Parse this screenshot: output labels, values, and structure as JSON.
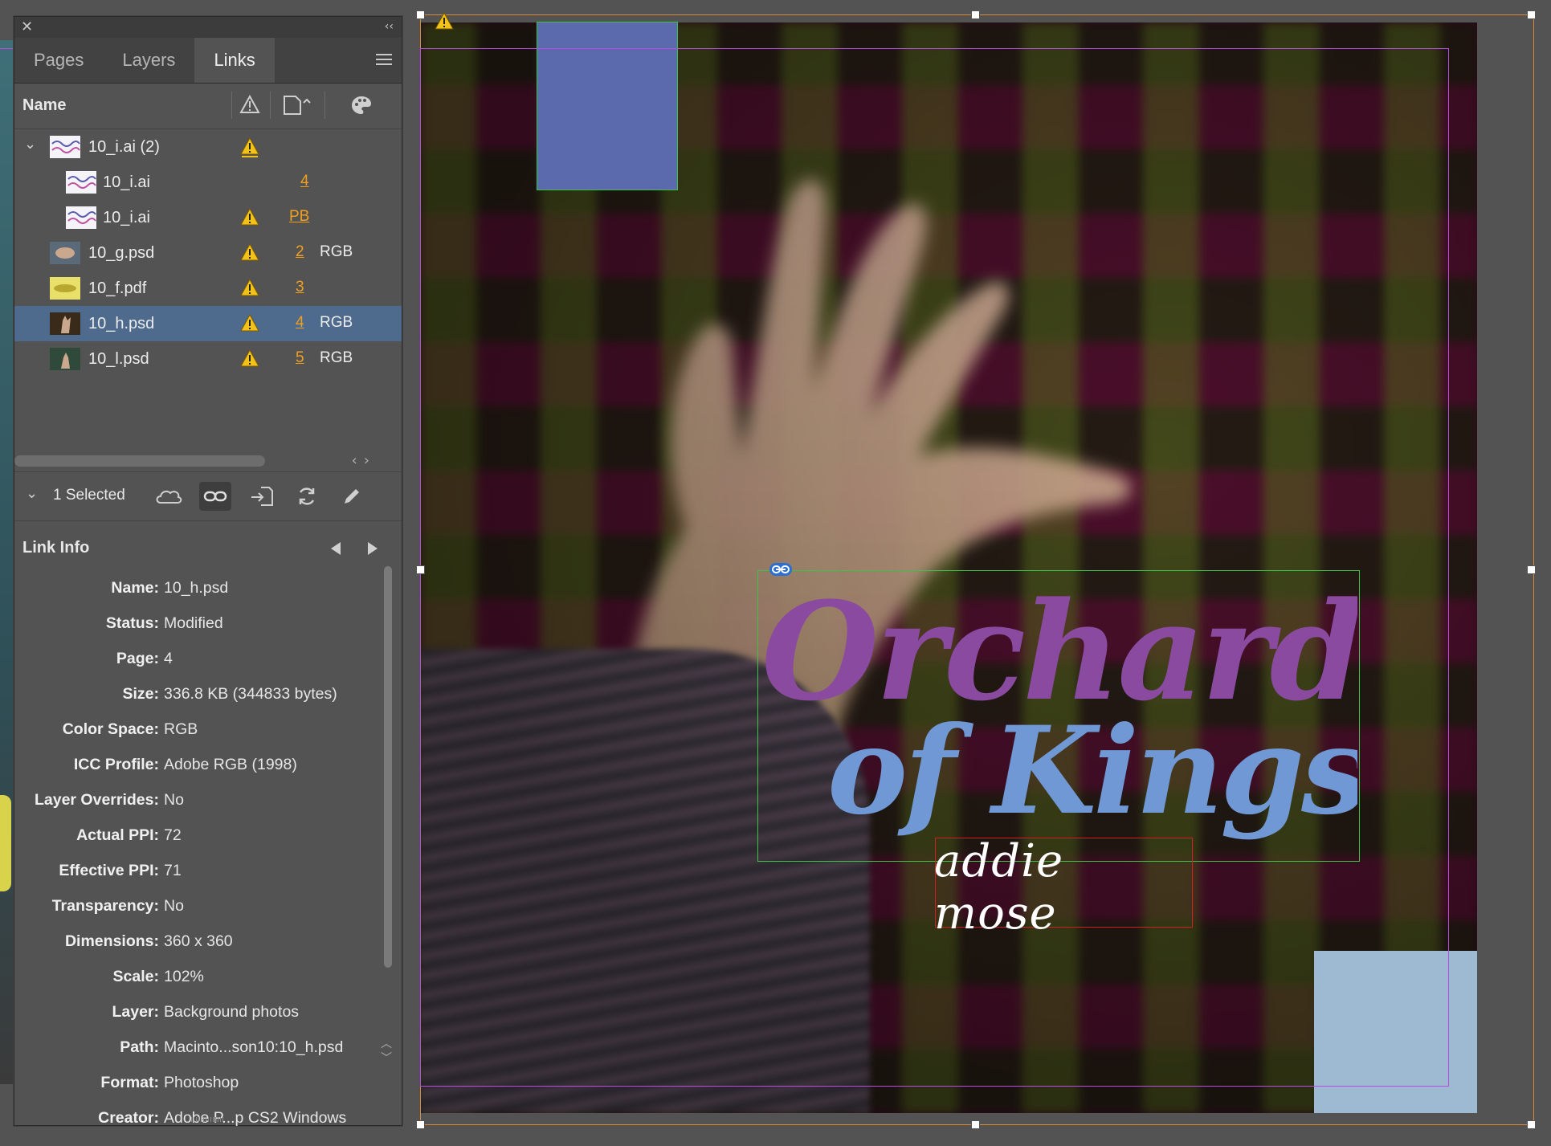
{
  "panel": {
    "tabs": [
      {
        "label": "Pages"
      },
      {
        "label": "Layers"
      },
      {
        "label": "Links"
      }
    ],
    "active_tab": "Links",
    "column_header": {
      "name": "Name"
    },
    "links": [
      {
        "name": "10_i.ai (2)",
        "page": "",
        "color_space": "",
        "warning": true,
        "expanded": true
      },
      {
        "name": "10_i.ai",
        "page": "4",
        "color_space": "",
        "warning": false
      },
      {
        "name": "10_i.ai",
        "page": "PB",
        "color_space": "",
        "warning": true
      },
      {
        "name": "10_g.psd",
        "page": "2",
        "color_space": "RGB",
        "warning": true
      },
      {
        "name": "10_f.pdf",
        "page": "3",
        "color_space": "",
        "warning": true
      },
      {
        "name": "10_h.psd",
        "page": "4",
        "color_space": "RGB",
        "warning": true,
        "selected": true
      },
      {
        "name": "10_l.psd",
        "page": "5",
        "color_space": "RGB",
        "warning": true
      }
    ],
    "selection_count": "1 Selected",
    "link_info": {
      "title": "Link Info",
      "fields": [
        {
          "label": "Name:",
          "value": "10_h.psd"
        },
        {
          "label": "Status:",
          "value": "Modified"
        },
        {
          "label": "Page:",
          "value": "4"
        },
        {
          "label": "Size:",
          "value": "336.8 KB (344833 bytes)"
        },
        {
          "label": "Color Space:",
          "value": "RGB"
        },
        {
          "label": "ICC Profile:",
          "value": "Adobe RGB (1998)"
        },
        {
          "label": "Layer Overrides:",
          "value": "No"
        },
        {
          "label": "Actual PPI:",
          "value": "72"
        },
        {
          "label": "Effective PPI:",
          "value": "71"
        },
        {
          "label": "Transparency:",
          "value": "No"
        },
        {
          "label": "Dimensions:",
          "value": "360 x 360"
        },
        {
          "label": "Scale:",
          "value": "102%"
        },
        {
          "label": "Layer:",
          "value": "Background photos"
        },
        {
          "label": "Path:",
          "value": "Macinto...son10:10_h.psd"
        },
        {
          "label": "Format:",
          "value": "Photoshop"
        },
        {
          "label": "Creator:",
          "value": "Adobe P...p CS2 Windows"
        }
      ]
    }
  },
  "document": {
    "title_line1": "Orchard",
    "title_line2": "of Kings",
    "author": "addie mose",
    "colors": {
      "title_purple": "#8a4aa0",
      "title_blue": "#6f98d4",
      "frame_green": "#3cc24a",
      "frame_red": "#d02020",
      "guide_magenta": "#b84de0",
      "page_page_accent": "#5b6aad",
      "light_blue_block": "#9ebad2",
      "warning_yellow": "#f2c21b",
      "page_number_orange": "#f0a020",
      "selected_row": "#4e6a8c"
    }
  },
  "icons": {
    "close": "close-icon",
    "collapse": "double-chevron-left-icon",
    "panel_menu": "hamburger-menu-icon",
    "warning": "warning-triangle-icon",
    "page_column": "page-icon",
    "color_space_column": "palette-icon",
    "cloud": "cloud-icon",
    "relink": "chain-link-icon",
    "goto_link": "goto-link-icon",
    "update": "refresh-icon",
    "edit_original": "pencil-icon"
  }
}
